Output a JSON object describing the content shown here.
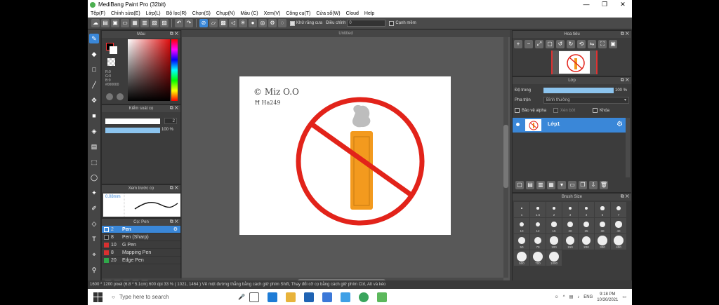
{
  "window": {
    "title": "MediBang Paint Pro (32bit)",
    "controls": [
      "—",
      "❐",
      "✕"
    ]
  },
  "menu": [
    "Tệp(F)",
    "Chỉnh sửa(E)",
    "Lớp(L)",
    "Bộ lọc(R)",
    "Chọn(S)",
    "Chụp(N)",
    "Màu (C)",
    "Xem(V)",
    "Công cụ(T)",
    "Cửa sổ(W)",
    "Cloud",
    "Help"
  ],
  "toolbar": {
    "antialias_label": "Khử răng cưa",
    "adjust_label": "Điều chỉnh",
    "adjust_value": "0",
    "edge_label": "Cạnh mềm"
  },
  "color_panel": {
    "title": "Màu",
    "r": "R:0",
    "g": "G:0",
    "b": "B:0",
    "hex": "#000000"
  },
  "brush_control": {
    "title": "Kiểm soát cọ",
    "size_value": "2",
    "opacity_value": "100 %",
    "opacity_fraction": 1.0
  },
  "brush_preview": {
    "title": "Xem trước cọ",
    "size_label": "0.08mm"
  },
  "pen_list": {
    "title": "Cọ: Pen",
    "items": [
      {
        "size": "2",
        "name": "Pen",
        "color": "#3a87d8",
        "selected": true
      },
      {
        "size": "8",
        "name": "Pen (Sharp)",
        "color": "#222222",
        "selected": false
      },
      {
        "size": "10",
        "name": "G Pen",
        "color": "#d93030",
        "selected": false
      },
      {
        "size": "8",
        "name": "Mapping Pen",
        "color": "#d93030",
        "selected": false
      },
      {
        "size": "20",
        "name": "Edge Pen",
        "color": "#2fa84a",
        "selected": false
      }
    ]
  },
  "canvas": {
    "tab": "Untitled",
    "handwriting_line1": "© Miz O.O",
    "handwriting_line2": "Ħ Ha249",
    "sign_color": "#e2231a",
    "smoke_color": "#bdbdbd",
    "cigarette_color": "#f39a1e",
    "cigarette_dark": "#c77a12"
  },
  "navigator": {
    "title": "Hoa tiêu"
  },
  "layers": {
    "title": "Lớp",
    "opacity_label": "Độ trong",
    "opacity_value": "100 %",
    "opacity_fraction": 1.0,
    "blend_label": "Pha trộn",
    "blend_value": "Bình thường",
    "protect_alpha": "Bảo vệ alpha",
    "clipping": "Xén bớt",
    "lock": "Khóa",
    "layer_name": "Lớp1"
  },
  "brush_size": {
    "title": "Brush Size",
    "sizes": [
      "1",
      "1.5",
      "2",
      "3",
      "4",
      "5",
      "7",
      "10",
      "12",
      "15",
      "20",
      "25",
      "30",
      "40",
      "50",
      "70",
      "100",
      "150",
      "200",
      "300",
      "400",
      "500",
      "700",
      "1000"
    ]
  },
  "status": {
    "text": "1600 * 1200 pixel  (6.8 * 5.1cm)  600 dpi  33 %  ( 1021, 1464 )  Vẽ một đường thẳng bằng cách giữ phím Shift, Thay đổi cỡ cọ bằng cách giữ phím Ctrl, Alt và kéo"
  },
  "taskbar": {
    "search_placeholder": "Type here to search",
    "language": "ENG",
    "time": "9:18 PM",
    "date": "10/30/2021"
  }
}
